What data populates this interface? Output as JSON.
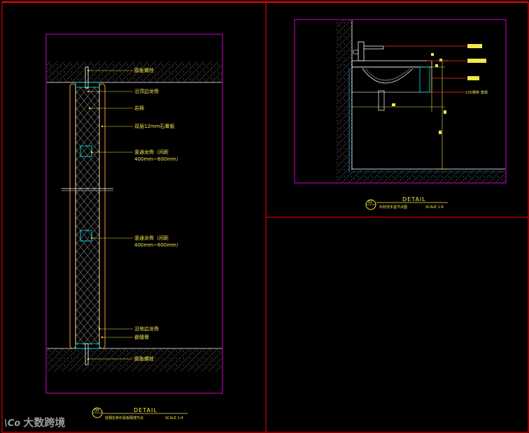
{
  "left_detail": {
    "callouts": {
      "bolt_top": "膨胀螺栓",
      "top_edge_stud": "沿顶边龙骨",
      "rock_wool": "岩棉",
      "gypsum_board": "双层12mm石膏板",
      "cross_stud_1a": "竖通龙骨（间距",
      "cross_stud_1b": "400mm~600mm）",
      "cross_stud_2a": "竖通龙骨（间距",
      "cross_stud_2b": "400mm~600mm）",
      "floor_edge_stud": "沿地边龙骨",
      "caulk": "嵌缝膏",
      "bolt_bottom": "膨胀螺栓"
    },
    "title_block": {
      "number": "08",
      "detail": "DETAIL",
      "name": "轻钢龙骨石膏板隔墙节点",
      "scale": "SCALE 1:4"
    }
  },
  "right_detail": {
    "callouts": {
      "steel_note": "L50钢骨 角钢"
    },
    "title_block": {
      "number": "02",
      "detail": "DETAIL",
      "name": "石材洗手盆节点图",
      "scale": "SCALE 1:8"
    }
  },
  "watermark": {
    "logo": "\\Co",
    "text": "大数跨境"
  },
  "colors": {
    "frame": "#ff0000",
    "viewport": "#d000d0",
    "annotation": "#f5e64a",
    "linework": "#ffffff",
    "stud": "#00e0e0"
  }
}
